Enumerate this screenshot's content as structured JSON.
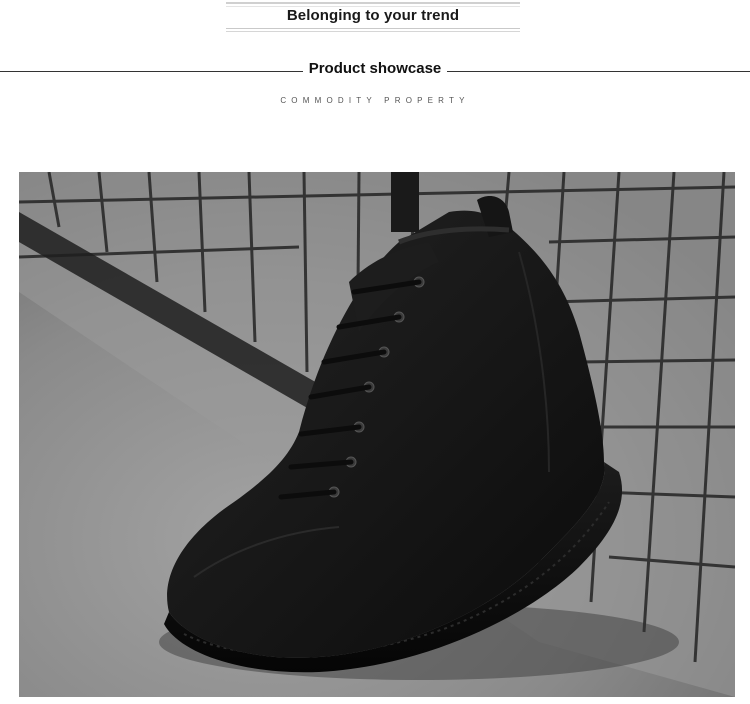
{
  "banner": {
    "tagline": "Belonging to your trend"
  },
  "section": {
    "title": "Product showcase",
    "subtitle": "COMMODITY PROPERTY"
  },
  "product_image": {
    "subject": "black high-top lace-up canvas boot",
    "icon": "boot-photo"
  },
  "colors": {
    "background": "#ffffff",
    "text": "#111111",
    "boot": "#141414",
    "floor": "#8e8e8e",
    "grid": "#2b2b2b"
  }
}
